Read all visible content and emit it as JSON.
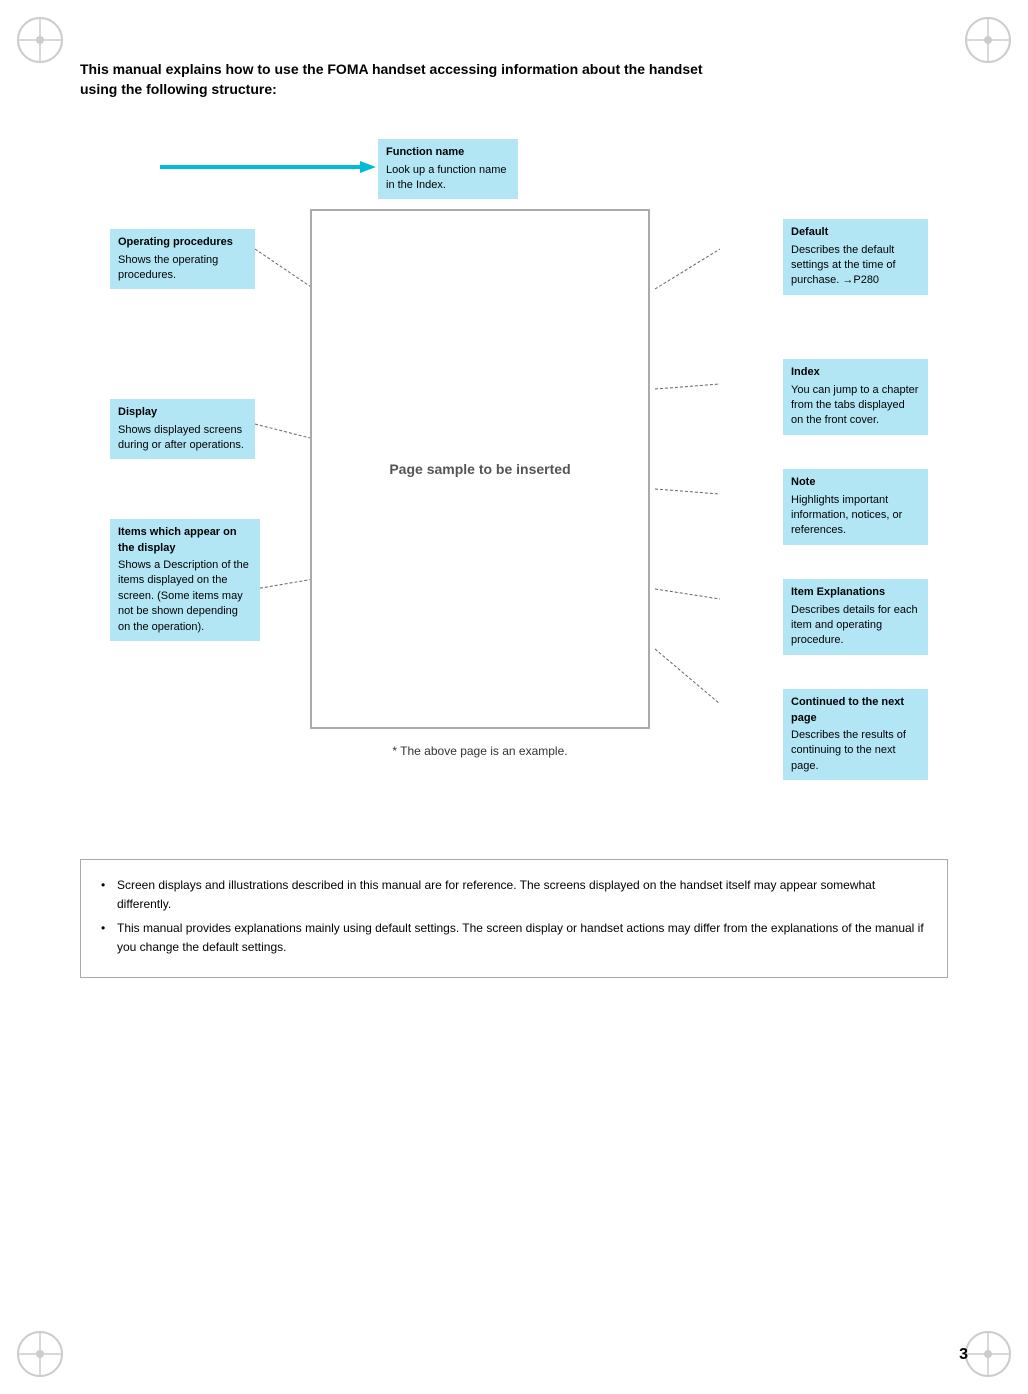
{
  "header": {
    "title": "This manual explains how to use the FOMA handset accessing information about the handset using the following structure:"
  },
  "function_name_box": {
    "title": "Function name",
    "description": "Look up a function name in the Index."
  },
  "left_annotations": [
    {
      "id": "operating-procedures",
      "title": "Operating procedures",
      "description": "Shows the operating procedures."
    },
    {
      "id": "display",
      "title": "Display",
      "description": "Shows displayed screens during or after operations."
    },
    {
      "id": "items-display",
      "title": "Items which appear on the display",
      "description": "Shows a Description of the items displayed on the screen. (Some items may not be shown depending on the operation)."
    }
  ],
  "right_annotations": [
    {
      "id": "default",
      "title": "Default",
      "description": "Describes the default settings at the time of purchase. →P280"
    },
    {
      "id": "index",
      "title": "Index",
      "description": "You can jump to a chapter from the tabs displayed on the front cover."
    },
    {
      "id": "note",
      "title": "Note",
      "description": "Highlights important information, notices, or references."
    },
    {
      "id": "item-explanations",
      "title": "Item Explanations",
      "description": "Describes details for each item and operating procedure."
    },
    {
      "id": "continued",
      "title": "Continued to the next page",
      "description": "Describes the results of continuing to the next page."
    }
  ],
  "center_page": {
    "text": "Page sample to be inserted"
  },
  "caption": {
    "text": "* The above page is an example."
  },
  "bottom_notes": [
    "Screen displays and illustrations described in this manual are for reference. The screens displayed on the handset itself may appear somewhat differently.",
    "This manual provides explanations mainly using default settings. The screen display or handset actions may differ from the explanations of the manual if you change the default settings."
  ],
  "page_number": "3"
}
